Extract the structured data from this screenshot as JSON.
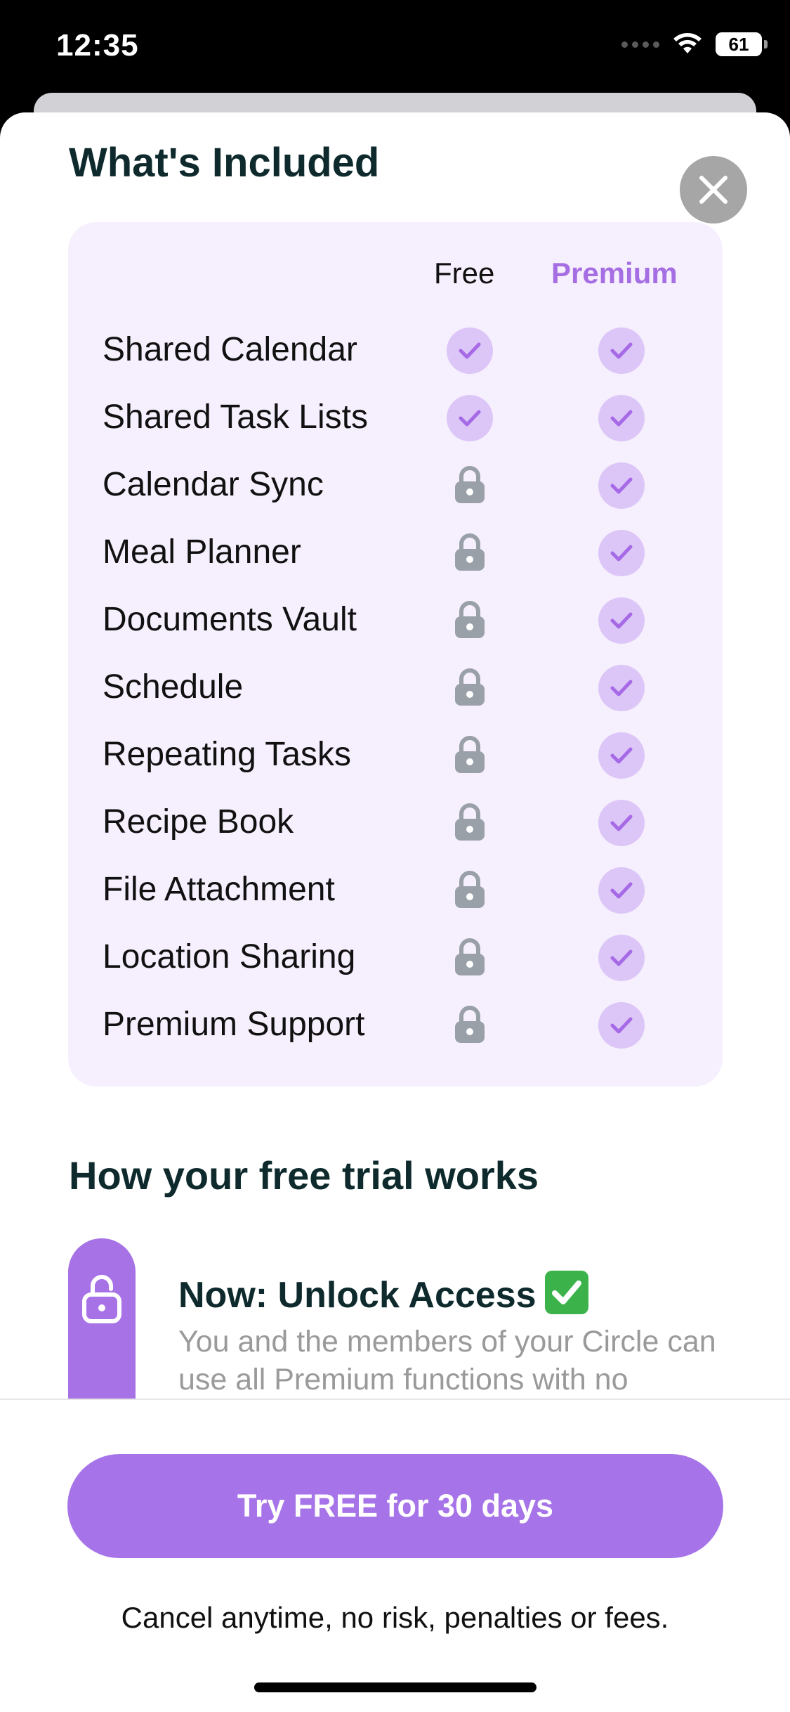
{
  "status_bar": {
    "time": "12:35",
    "battery": "61"
  },
  "included": {
    "title": "What's Included",
    "col_free": "Free",
    "col_premium": "Premium",
    "features": [
      {
        "label": "Shared Calendar",
        "free": true,
        "premium": true
      },
      {
        "label": "Shared Task Lists",
        "free": true,
        "premium": true
      },
      {
        "label": "Calendar Sync",
        "free": false,
        "premium": true
      },
      {
        "label": "Meal Planner",
        "free": false,
        "premium": true
      },
      {
        "label": "Documents Vault",
        "free": false,
        "premium": true
      },
      {
        "label": "Schedule",
        "free": false,
        "premium": true
      },
      {
        "label": "Repeating Tasks",
        "free": false,
        "premium": true
      },
      {
        "label": "Recipe Book",
        "free": false,
        "premium": true
      },
      {
        "label": "File Attachment",
        "free": false,
        "premium": true
      },
      {
        "label": "Location Sharing",
        "free": false,
        "premium": true
      },
      {
        "label": "Premium Support",
        "free": false,
        "premium": true
      }
    ]
  },
  "trial": {
    "title": "How your free trial works",
    "step_title": "Now: Unlock Access",
    "step_desc": "You and the members of your Circle can use all Premium functions with no"
  },
  "footer": {
    "cta_label": "Try FREE for 30 days",
    "note": "Cancel anytime, no risk, penalties or fees."
  },
  "colors": {
    "accent": "#a674e8",
    "card_bg": "#f6effd",
    "check_bg": "#dcc6f7",
    "lock": "#9aa0a8"
  },
  "icons": [
    "close-icon",
    "check-icon",
    "lock-icon",
    "wifi-icon",
    "battery-icon"
  ]
}
